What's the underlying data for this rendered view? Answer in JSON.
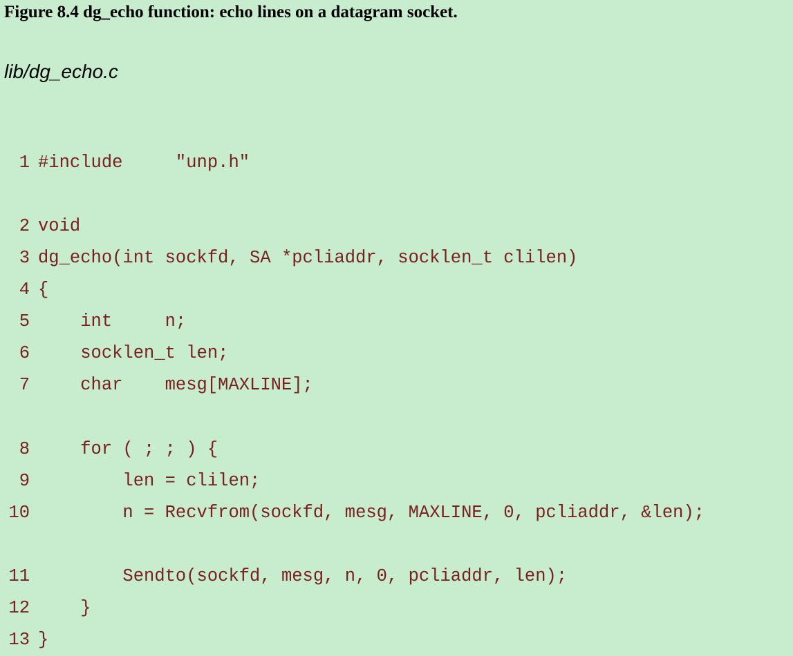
{
  "caption": "Figure 8.4 dg_echo function: echo lines on a datagram socket.",
  "filename": "lib/dg_echo.c",
  "code_lines": [
    {
      "num": "1",
      "text": "#include     \"unp.h\""
    },
    {
      "num": "2",
      "text": "void"
    },
    {
      "num": "3",
      "text": "dg_echo(int sockfd, SA *pcliaddr, socklen_t clilen)"
    },
    {
      "num": "4",
      "text": "{"
    },
    {
      "num": "5",
      "text": "    int     n;"
    },
    {
      "num": "6",
      "text": "    socklen_t len;"
    },
    {
      "num": "7",
      "text": "    char    mesg[MAXLINE];"
    },
    {
      "num": "8",
      "text": "    for ( ; ; ) {"
    },
    {
      "num": "9",
      "text": "        len = clilen;"
    },
    {
      "num": "10",
      "text": "        n = Recvfrom(sockfd, mesg, MAXLINE, 0, pcliaddr, &len);"
    },
    {
      "num": "11",
      "text": "        Sendto(sockfd, mesg, n, 0, pcliaddr, len);"
    },
    {
      "num": "12",
      "text": "    }"
    },
    {
      "num": "13",
      "text": "}"
    }
  ]
}
